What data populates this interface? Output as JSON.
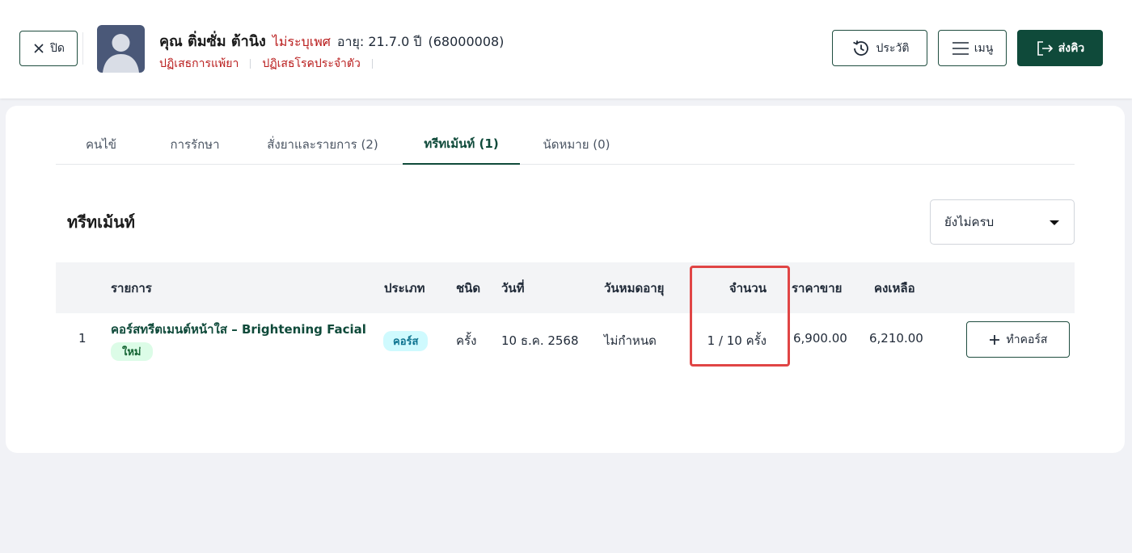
{
  "header": {
    "close_label": "ปิด",
    "patient": {
      "name": "คุณ ติ่มซั่ม ต้านิง",
      "gender": "ไม่ระบุเพศ",
      "age": "อายุ: 21.7.0 ปี",
      "code": "(68000008)"
    },
    "notes": [
      "ปฏิเสธการแพ้ยา",
      "ปฏิเสธโรคประจำตัว"
    ],
    "history_label": "ประวัติ",
    "menu_label": "เมนู",
    "queue_label": "ส่งคิว"
  },
  "tabs": [
    {
      "label": "คนไข้"
    },
    {
      "label": "การรักษา"
    },
    {
      "label": "สั่งยาและรายการ (2)"
    },
    {
      "label": "ทรีทเม้นท์ (1)"
    },
    {
      "label": "นัดหมาย (0)"
    }
  ],
  "active_tab": "ทรีทเม้นท์ (1)",
  "section": {
    "title": "ทรีทเม้นท์",
    "filter_value": "ยังไม่ครบ"
  },
  "table": {
    "headers": {
      "item": "รายการ",
      "type": "ประเภท",
      "kind": "ชนิด",
      "date": "วันที่",
      "expiry": "วันหมดอายุ",
      "qty": "จำนวน",
      "price": "ราคาขาย",
      "remaining": "คงเหลือ"
    },
    "rows": [
      {
        "index": "1",
        "name": "คอร์สทรีตเมนต์หน้าใส – Brightening Facial",
        "badge": "ใหม่",
        "type": "คอร์ส",
        "kind": "ครั้ง",
        "date": "10 ธ.ค. 2568",
        "expiry": "ไม่กำหนด",
        "qty": "1 / 10 ครั้ง",
        "price": "6,900.00",
        "remaining": "6,210.00",
        "action_label": "ทำคอร์ส"
      }
    ]
  },
  "colors": {
    "primary": "#0f4a3a",
    "danger_text": "#b91c1c",
    "highlight_border": "#e04545",
    "badge_new_bg": "#dcfce7",
    "badge_type_bg": "#cffafe"
  }
}
